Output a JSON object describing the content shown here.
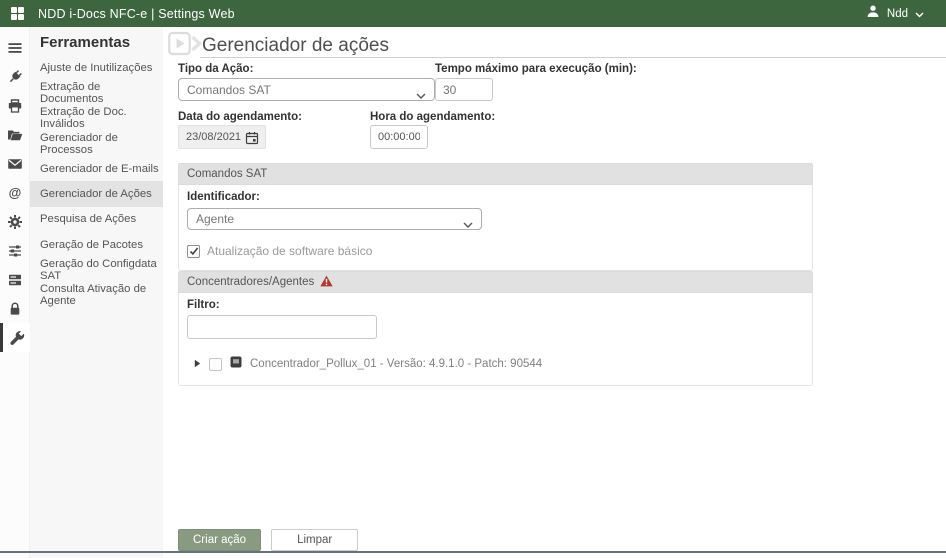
{
  "colors": {
    "topbar_green": "#3d663f",
    "primary_button_green": "#889b80",
    "warning_red": "#b0392e",
    "panel_header_gray": "#e1e1e1",
    "sidebar_active_gray": "#e3e3e3"
  },
  "topbar": {
    "title": "NDD i-Docs NFC-e | Settings Web",
    "user_label": "Ndd"
  },
  "icon_strip": {
    "items": [
      "menu",
      "plug",
      "printer",
      "folder",
      "mail",
      "at-sign",
      "gear",
      "sliders",
      "server",
      "lock",
      "wrench"
    ],
    "active": "wrench"
  },
  "sidebar": {
    "header": "Ferramentas",
    "items": [
      {
        "label": "Ajuste de Inutilizações",
        "active": false
      },
      {
        "label": "Extração de Documentos",
        "active": false
      },
      {
        "label": "Extração de Doc. Inválidos",
        "active": false
      },
      {
        "label": "Gerenciador de Processos",
        "active": false
      },
      {
        "label": "Gerenciador de E-mails",
        "active": false
      },
      {
        "label": "Gerenciador de Ações",
        "active": true
      },
      {
        "label": "Pesquisa de Ações",
        "active": false
      },
      {
        "label": "Geração de Pacotes",
        "active": false
      },
      {
        "label": "Geração do Configdata SAT",
        "active": false
      },
      {
        "label": "Consulta Ativação de Agente",
        "active": false
      }
    ]
  },
  "main": {
    "title": "Gerenciador de ações",
    "form": {
      "action_type_label": "Tipo da Ação:",
      "action_type_value": "Comandos SAT",
      "max_time_label": "Tempo máximo para execução (min):",
      "max_time_value": "30",
      "schedule_date_label": "Data do agendamento:",
      "schedule_date_value": "23/08/2021",
      "schedule_time_label": "Hora do agendamento:",
      "schedule_time_value": "00:00:00"
    },
    "sat_commands": {
      "header": "Comandos SAT",
      "identifier_label": "Identificador:",
      "identifier_value": "Agente",
      "basic_software_update_label": "Atualização de software básico",
      "basic_software_update_checked": true
    },
    "concentrators": {
      "header": "Concentradores/Agentes",
      "filter_label": "Filtro:",
      "filter_value": "",
      "tree_items": [
        {
          "label": "Concentrador_Pollux_01 - Versão: 4.9.1.0 - Patch: 90544",
          "checked": false,
          "expanded": false
        }
      ]
    },
    "actions": {
      "create_label": "Criar ação",
      "clear_label": "Limpar"
    }
  }
}
